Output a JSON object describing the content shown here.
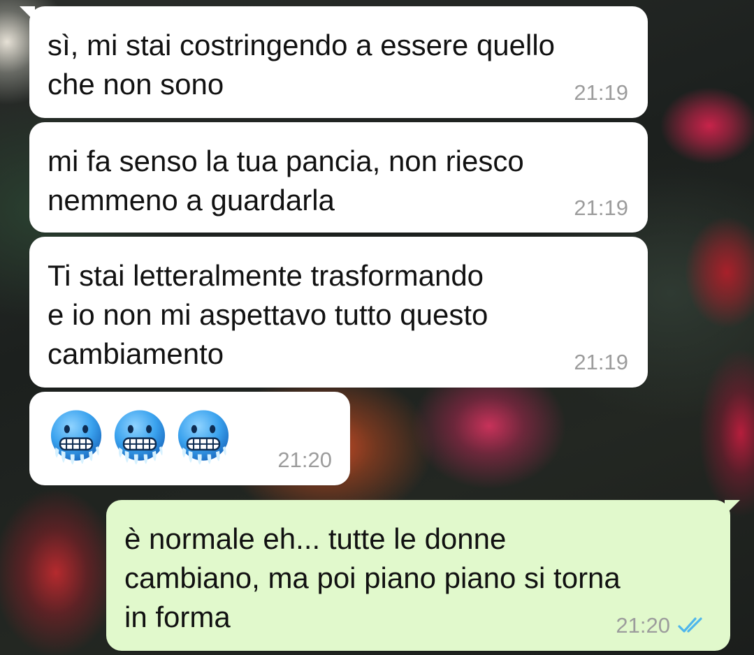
{
  "chat": {
    "messages": [
      {
        "direction": "incoming",
        "text": "sì, mi stai costringendo a essere quello\nche non sono",
        "time": "21:19"
      },
      {
        "direction": "incoming",
        "text": "mi fa senso la tua pancia, non riesco\nnemmeno a guardarla",
        "time": "21:19"
      },
      {
        "direction": "incoming",
        "text": "Ti stai letteralmente trasformando\ne io non mi aspettavo tutto questo\ncambiamento",
        "time": "21:19"
      },
      {
        "direction": "incoming",
        "emoji": [
          "cold-face-emoji",
          "cold-face-emoji",
          "cold-face-emoji"
        ],
        "time": "21:20"
      },
      {
        "direction": "outgoing",
        "text": "è normale eh... tutte le donne\ncambiano, ma poi piano piano si torna\nin forma",
        "time": "21:20",
        "status": "read",
        "status_icon": "double-check-icon",
        "status_color": "#4fb6ec"
      }
    ],
    "colors": {
      "incoming_bubble": "#ffffff",
      "outgoing_bubble": "#e1f9cc",
      "timestamp": "#9c9c9c",
      "message_text": "#111111"
    }
  }
}
